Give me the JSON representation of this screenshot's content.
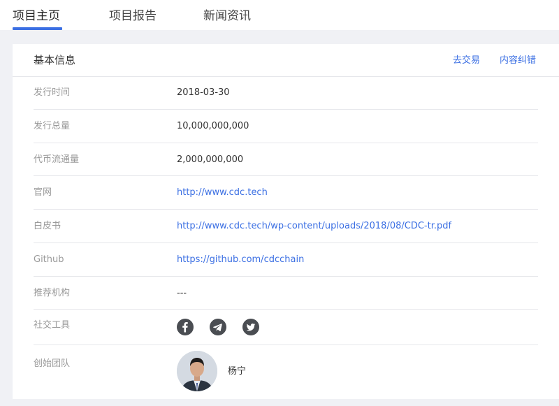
{
  "tabs": [
    {
      "label": "项目主页",
      "active": true
    },
    {
      "label": "项目报告",
      "active": false
    },
    {
      "label": "新闻资讯",
      "active": false
    }
  ],
  "card": {
    "title": "基本信息",
    "actions": [
      "去交易",
      "内容纠错"
    ]
  },
  "info_rows": [
    {
      "label": "发行时间",
      "value": "2018-03-30"
    },
    {
      "label": "发行总量",
      "value": "10,000,000,000"
    },
    {
      "label": "代币流通量",
      "value": "2,000,000,000"
    },
    {
      "label": "官网",
      "value": "http://www.cdc.tech"
    },
    {
      "label": "白皮书",
      "value": "http://www.cdc.tech/wp-content/uploads/2018/08/CDC-tr.pdf"
    },
    {
      "label": "Github",
      "value": "https://github.com/cdcchain"
    },
    {
      "label": "推荐机构",
      "value": "---"
    }
  ],
  "social": {
    "label": "社交工具",
    "icons": [
      "facebook-icon",
      "telegram-icon",
      "twitter-icon"
    ]
  },
  "team": {
    "label": "创始团队",
    "members": [
      {
        "name": "杨宁"
      }
    ]
  },
  "colors": {
    "accent": "#3b6fe3",
    "page_bg": "#f0f1f5",
    "label_gray": "#9a9a9a",
    "icon_dark": "#4a4d52"
  }
}
